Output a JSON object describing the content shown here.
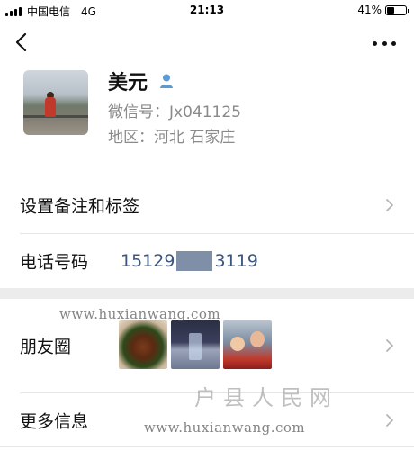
{
  "status_bar": {
    "carrier": "中国电信",
    "network": "4G",
    "time": "21:13",
    "battery_text": "41%",
    "battery_level": 0.41
  },
  "nav": {
    "back_icon": "chevron-left-icon",
    "more_icon": "more-dots-icon"
  },
  "profile": {
    "name": "美元",
    "badge_icon": "person-badge-icon",
    "wechat_id": "微信号：Jx041125",
    "region": "地区：河北 石家庄"
  },
  "rows": {
    "remark_label": "设置备注和标签",
    "phone_label": "电话号码",
    "phone_prefix": "15129",
    "phone_suffix": "3119",
    "moments_label": "朋友圈",
    "more_info_label": "更多信息"
  },
  "watermark": {
    "url": "www.huxianwang.com",
    "site_name": "户县人民网"
  },
  "colors": {
    "phone_text": "#3c5680",
    "secondary_text": "#8a8a8a",
    "section_gap": "#ececec",
    "badge": "#5b9bd5"
  }
}
